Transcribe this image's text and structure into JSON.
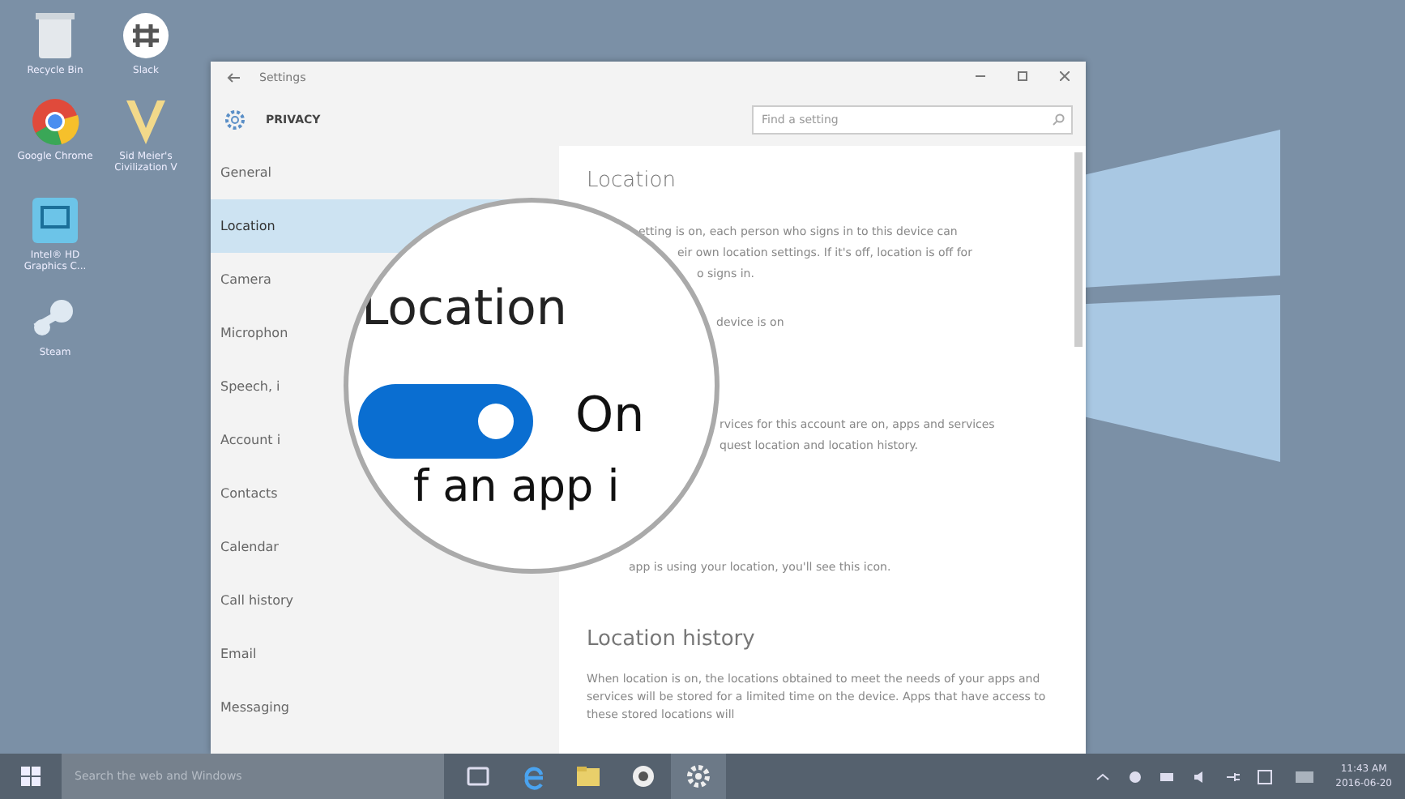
{
  "desktop": {
    "icon_rows": [
      [
        {
          "label": "Recycle Bin",
          "kind": "bin"
        },
        {
          "label": "Slack",
          "kind": "slack"
        }
      ],
      [
        {
          "label": "Google Chrome",
          "kind": "chrome"
        },
        {
          "label": "Sid Meier's Civilization V",
          "kind": "civ"
        }
      ],
      [
        {
          "label": "Intel® HD Graphics C...",
          "kind": "intel"
        }
      ],
      [
        {
          "label": "Steam",
          "kind": "steam"
        }
      ]
    ]
  },
  "window": {
    "title": "Settings",
    "section": "PRIVACY",
    "search": {
      "placeholder": "Find a setting"
    },
    "nav": [
      {
        "label": "General",
        "selected": false
      },
      {
        "label": "Location",
        "selected": true
      },
      {
        "label": "Camera",
        "selected": false
      },
      {
        "label": "Microphon",
        "selected": false
      },
      {
        "label": "Speech, i",
        "selected": false
      },
      {
        "label": "Account i",
        "selected": false
      },
      {
        "label": "Contacts",
        "selected": false
      },
      {
        "label": "Calendar",
        "selected": false
      },
      {
        "label": "Call history",
        "selected": false
      },
      {
        "label": "Email",
        "selected": false
      },
      {
        "label": "Messaging",
        "selected": false
      }
    ],
    "content": {
      "heading": "Location",
      "lines": [
        "etting is on, each person who signs in to this device can",
        "eir own location settings. If it's off, location is off for",
        "o signs in.",
        "device is on",
        "rvices for this account are on, apps and services",
        "quest location and location history.",
        "app is using your location, you'll see this icon."
      ],
      "history_heading": "Location history",
      "history_text": "When location is on, the locations obtained to meet the needs of your apps and services will be stored for a limited time on the device. Apps that have access to these stored locations will"
    }
  },
  "magnifier": {
    "title": "Location",
    "toggle": {
      "on": true
    },
    "state_label": "On",
    "partial_text": "f an app i"
  },
  "taskbar": {
    "search_placeholder": "Search the web and Windows",
    "apps": [
      {
        "kind": "taskview",
        "selected": false
      },
      {
        "kind": "edge",
        "selected": false
      },
      {
        "kind": "explorer",
        "selected": false
      },
      {
        "kind": "app",
        "selected": false
      },
      {
        "kind": "settings",
        "selected": true
      }
    ],
    "time": "11:43 AM",
    "date": "2016-06-20"
  }
}
